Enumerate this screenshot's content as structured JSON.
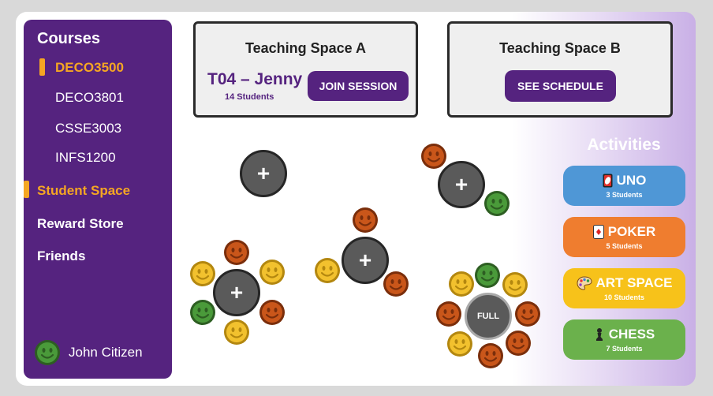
{
  "sidebar": {
    "courses_heading": "Courses",
    "courses": [
      "DECO3500",
      "DECO3801",
      "CSSE3003",
      "INFS1200"
    ],
    "nav": [
      "Student Space",
      "Reward Store",
      "Friends"
    ],
    "user_name": "John Citizen"
  },
  "teaching_spaces": [
    {
      "title": "Teaching Space A",
      "session": "T04 – Jenny",
      "students": "14 Students",
      "button": "JOIN SESSION"
    },
    {
      "title": "Teaching Space B",
      "button": "SEE SCHEDULE"
    }
  ],
  "activities": {
    "title": "Activities",
    "items": [
      {
        "name": "UNO",
        "students": "3 Students",
        "color": "#4f97d6",
        "icon": "uno-card-icon"
      },
      {
        "name": "POKER",
        "students": "5 Students",
        "color": "#ef7d2f",
        "icon": "playing-card-icon"
      },
      {
        "name": "ART SPACE",
        "students": "10 Students",
        "color": "#f7c21a",
        "icon": "palette-icon"
      },
      {
        "name": "CHESS",
        "students": "7 Students",
        "color": "#6bb14c",
        "icon": "chess-pawn-icon"
      }
    ]
  },
  "tables": {
    "join_symbol": "+",
    "full_label": "FULL"
  },
  "colors": {
    "purple": "#55237f",
    "accent": "#f5a623",
    "smiley_yellow": "#f2c12e",
    "smiley_orange": "#c9561a",
    "smiley_green": "#4a9a3a"
  }
}
